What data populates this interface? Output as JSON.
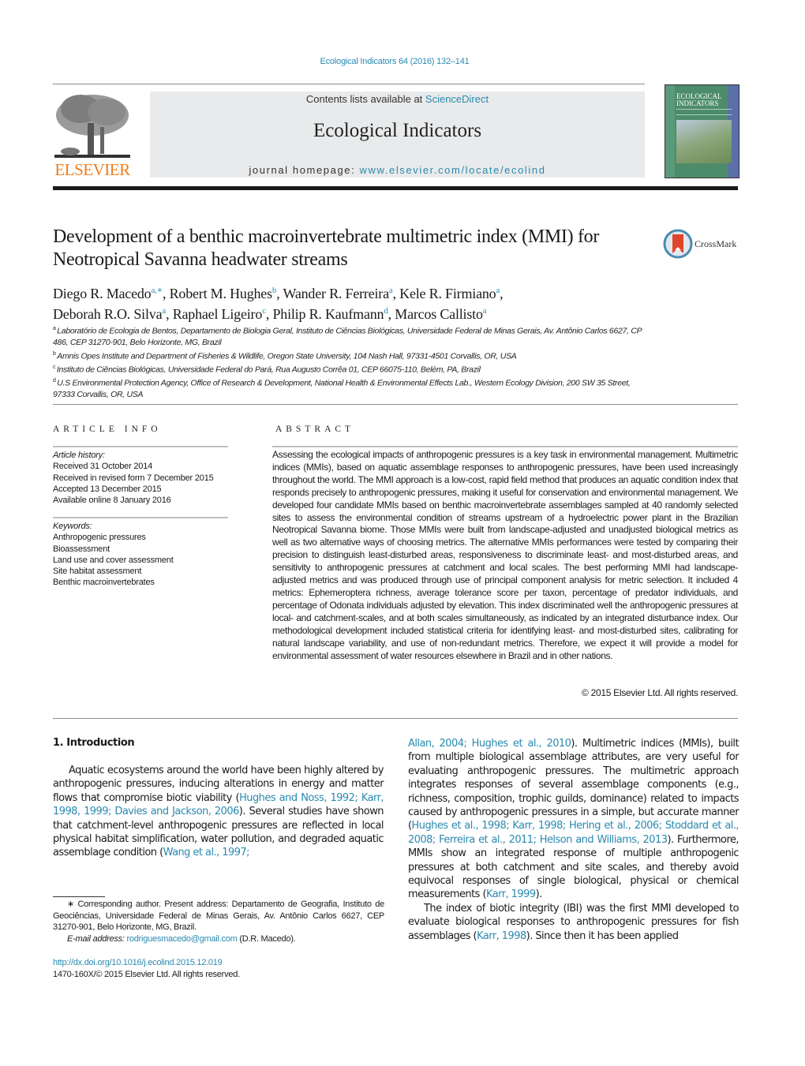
{
  "header": {
    "citation": "Ecological Indicators 64 (2016) 132–141",
    "contents_prefix": "Contents lists available at ",
    "contents_link": "ScienceDirect",
    "journal_name": "Ecological Indicators",
    "homepage_prefix": "journal homepage: ",
    "homepage_link": "www.elsevier.com/locate/ecolind",
    "publisher_logo_text": "ELSEVIER",
    "cover_title_line1": "ECOLOGICAL",
    "cover_title_line2": "INDICATORS",
    "crossmark_label": "CrossMark"
  },
  "article": {
    "title": "Development of a benthic macroinvertebrate multimetric index (MMI) for Neotropical Savanna headwater streams",
    "authors": [
      {
        "name": "Diego R. Macedo",
        "aff": "a,∗",
        "sep": ", "
      },
      {
        "name": "Robert M. Hughes",
        "aff": "b",
        "sep": ", "
      },
      {
        "name": "Wander R. Ferreira",
        "aff": "a",
        "sep": ", "
      },
      {
        "name": "Kele R. Firmiano",
        "aff": "a",
        "sep": ","
      },
      {
        "name": "Deborah R.O. Silva",
        "aff": "a",
        "sep": ", "
      },
      {
        "name": "Raphael Ligeiro",
        "aff": "c",
        "sep": ", "
      },
      {
        "name": "Philip R. Kaufmann",
        "aff": "d",
        "sep": ", "
      },
      {
        "name": "Marcos Callisto",
        "aff": "a",
        "sep": ""
      }
    ],
    "affiliations": [
      {
        "key": "a",
        "text": "Laboratório de Ecologia de Bentos, Departamento de Biologia Geral, Instituto de Ciências Biológicas, Universidade Federal de Minas Gerais, Av. Antônio Carlos 6627, CP 486, CEP 31270-901, Belo Horizonte, MG, Brazil"
      },
      {
        "key": "b",
        "text": "Amnis Opes Institute and Department of Fisheries & Wildlife, Oregon State University, 104 Nash Hall, 97331-4501 Corvallis, OR, USA"
      },
      {
        "key": "c",
        "text": "Instituto de Ciências Biológicas, Universidade Federal do Pará, Rua Augusto Corrêa 01, CEP 66075-110, Belém, PA, Brazil"
      },
      {
        "key": "d",
        "text": "U.S Environmental Protection Agency, Office of Research & Development, National Health & Environmental Effects Lab., Western Ecology Division, 200 SW 35 Street, 97333 Corvallis, OR, USA"
      }
    ]
  },
  "article_info": {
    "heading": "ARTICLE INFO",
    "history_label": "Article history:",
    "history": [
      "Received 31 October 2014",
      "Received in revised form 7 December 2015",
      "Accepted 13 December 2015",
      "Available online 8 January 2016"
    ],
    "keywords_label": "Keywords:",
    "keywords": [
      "Anthropogenic pressures",
      "Bioassessment",
      "Land use and cover assessment",
      "Site habitat assessment",
      "Benthic macroinvertebrates"
    ]
  },
  "abstract": {
    "heading": "ABSTRACT",
    "text": "Assessing the ecological impacts of anthropogenic pressures is a key task in environmental manage­ment. Multimetric indices (MMIs), based on aquatic assemblage responses to anthropogenic pressures, have been used increasingly throughout the world. The MMI approach is a low-cost, rapid field method that produces an aquatic condition index that responds precisely to anthropogenic pressures, making it useful for conservation and environmental management. We developed four candidate MMIs based on benthic macroinvertebrate assemblages sampled at 40 randomly selected sites to assess the envi­ronmental condition of streams upstream of a hydroelectric power plant in the Brazilian Neotropical Savanna biome. Those MMIs were built from landscape-adjusted and unadjusted biological metrics as well as two alternative ways of choosing metrics. The alternative MMIs performances were tested by comparing their precision to distinguish least-disturbed areas, responsiveness to discriminate least- and most-disturbed areas, and sensitivity to anthropogenic pressures at catchment and local scales. The best performing MMI had landscape-adjusted metrics and was produced through use of principal component analysis for metric selection. It included 4 metrics: Ephemeroptera richness, average tolerance score per taxon, percentage of predator individuals, and percentage of Odonata individuals adjusted by elevation. This index discriminated well the anthropogenic pressures at local- and catchment-scales, and at both scales simultaneously, as indicated by an integrated disturbance index. Our methodological develop­ment included statistical criteria for identifying least- and most-disturbed sites, calibrating for natural landscape variability, and use of non-redundant metrics. Therefore, we expect it will provide a model for environmental assessment of water resources elsewhere in Brazil and in other nations.",
    "copyright": "© 2015 Elsevier Ltd. All rights reserved."
  },
  "body": {
    "section_heading": "1.  Introduction",
    "left_para": [
      {
        "t": "Aquatic ecosystems around the world have been highly altered by anthropogenic pressures, inducing alterations in energy and matter flows that compromise biotic viability (",
        "link": false
      },
      {
        "t": "Hughes and Noss, 1992; Karr, 1998, 1999; Davies and Jackson, 2006",
        "link": true
      },
      {
        "t": "). Several stud­ies have shown that catchment-level anthropogenic pressures are reflected in local physical habitat simplification, water pollution, and degraded aquatic assemblage condition (",
        "link": false
      },
      {
        "t": "Wang et al., 1997;",
        "link": true
      }
    ],
    "right_para1": [
      {
        "t": "Allan, 2004; Hughes et al., 2010",
        "link": true
      },
      {
        "t": "). Multimetric indices (MMIs), built from multiple biological assemblage attributes, are very useful for evaluating anthropogenic pressures. The multimetric approach integrates responses of several assemblage components (e.g., richness, composition, trophic guilds, dominance) related to impacts caused by anthropogenic pressures in a simple, but accu­rate manner (",
        "link": false
      },
      {
        "t": "Hughes et al., 1998; Karr, 1998; Hering et al., 2006; Stoddard et al., 2008; Ferreira et al., 2011; Helson and Williams, 2013",
        "link": true
      },
      {
        "t": "). Furthermore, MMIs show an integrated response of multi­ple anthropogenic pressures at both catchment and site scales, and thereby avoid equivocal responses of single biological, physical or chemical measurements (",
        "link": false
      },
      {
        "t": "Karr, 1999",
        "link": true
      },
      {
        "t": ").",
        "link": false
      }
    ],
    "right_para2": [
      {
        "t": "The index of biotic integrity (IBI) was the first MMI devel­oped to evaluate biological responses to anthropogenic pressures for fish assemblages (",
        "link": false
      },
      {
        "t": "Karr, 1998",
        "link": true
      },
      {
        "t": "). Since then it has been applied",
        "link": false
      }
    ]
  },
  "footnotes": {
    "corresponding": "∗  Corresponding author. Present address: Departamento de Geografia, Instituto de Geociências, Universidade Federal de Minas Gerais, Av. Antônio Carlos 6627, CEP 31270-901, Belo Horizonte, MG, Brazil.",
    "email_label": "E-mail address: ",
    "email": "rodriguesmacedo@gmail.com",
    "email_suffix": " (D.R. Macedo).",
    "doi": "http://dx.doi.org/10.1016/j.ecolind.2015.12.019",
    "issn": "1470-160X/© 2015 Elsevier Ltd. All rights reserved."
  },
  "colors": {
    "link": "#2a8ab0",
    "elsevier_orange": "#f07d1a",
    "banner_bg": "#e9eaeb"
  }
}
